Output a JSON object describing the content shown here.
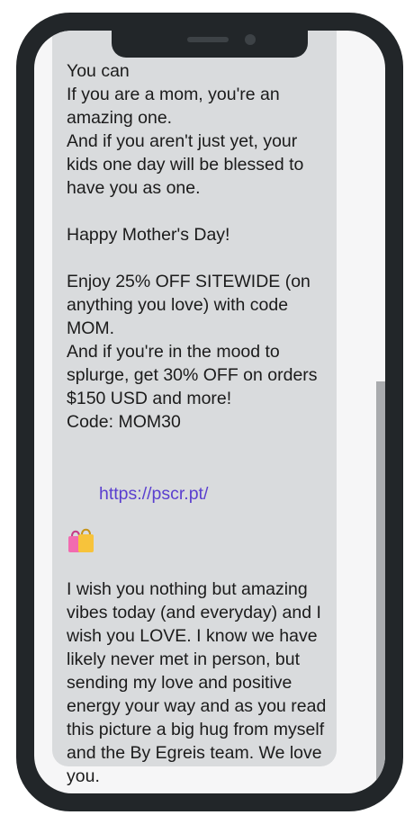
{
  "message": {
    "lines_top": "You can\nIf you are a mom, you're an amazing one.\nAnd if you aren't just yet, your kids one day will be blessed to have you as one.\n\nHappy Mother's Day!\n\nEnjoy 25% OFF SITEWIDE (on anything you love) with code MOM.\nAnd if you're in the mood to splurge, get 30% OFF on orders $150 USD and more!\nCode: MOM30",
    "link_icon": "shopping-bags-icon",
    "link_text": "https://pscr.pt/",
    "lines_bottom": "\nI wish you nothing but amazing vibes today (and everyday) and I wish you LOVE. I know we have likely never met in person, but sending my love and positive energy your way and as you read this picture a big hug from myself and the By Egreis team. We love you.\n\nxo,\nEgreis"
  },
  "colors": {
    "phone_frame": "#222629",
    "screen_bg": "#f6f6f7",
    "bubble_bg": "#d9dbdd",
    "link": "#5a3fcf",
    "scrollbar": "#a9abae"
  }
}
